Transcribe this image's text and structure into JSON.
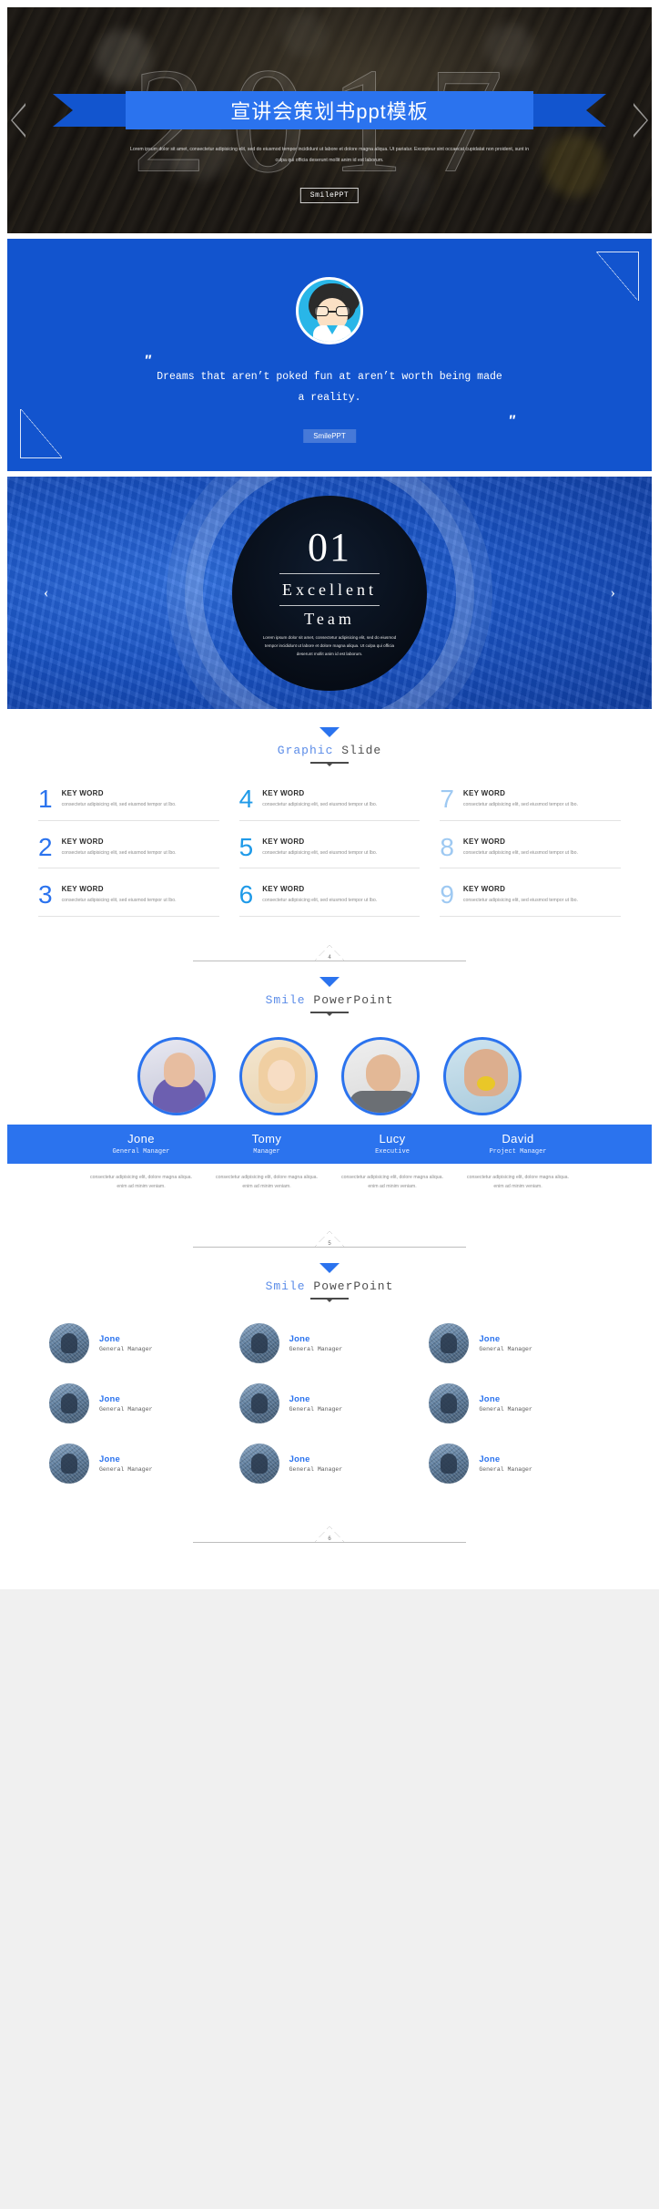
{
  "cover": {
    "year_ghost": "2017",
    "title": "宣讲会策划书ppt模板",
    "subtitle": "Lorem ipsum dolor sit amet, consectetur adipisicing elit, sed do eiusmod tempor incididunt ut labore et dolore magna aliqua. Ut pariatur. Excepteur sint occaecat cupidatat non proident, sunt in culpa qui officia deserunt mollit anim id est laborum.",
    "badge": "SmilePPT",
    "nav_left": "chevron-left",
    "nav_right": "chevron-right"
  },
  "quote_slide": {
    "quote_mark_open": "\"",
    "quote_mark_close": "\"",
    "text": "Dreams that aren’t poked fun at aren’t worth being made a reality.",
    "button": "SmilePPT",
    "accent": "#1254ce",
    "avatar": "boy-with-glasses-avatar"
  },
  "section_slide": {
    "number": "01",
    "title_line1": "Excellent",
    "title_line2": "Team",
    "description": "Lorem ipsum dolor sit amet, consectetur adipisicing elit, sed do eiusmod tempor incididunt ut labore et dolore magna aliqua. Ut culpa qui officia deserunt mollit anim id est laborum.",
    "prev": "‹",
    "next": "›"
  },
  "graphic_section": {
    "heading_accent": "Graphic",
    "heading_rest": " Slide",
    "items": [
      {
        "num": "1",
        "title": "KEY WORD",
        "desc": "consectetur adipisicing elit, sed eiusmod tempor ut lbo.",
        "color": "#2b73ee"
      },
      {
        "num": "4",
        "title": "KEY WORD",
        "desc": "consectetur adipisicing elit, sed eiusmod tempor ut lbo.",
        "color": "#1f9ae8"
      },
      {
        "num": "7",
        "title": "KEY WORD",
        "desc": "consectetur adipisicing elit, sed eiusmod tempor ut lbo.",
        "color": "#9ec9f2"
      },
      {
        "num": "2",
        "title": "KEY WORD",
        "desc": "consectetur adipisicing elit, sed eiusmod tempor ut lbo.",
        "color": "#2b73ee"
      },
      {
        "num": "5",
        "title": "KEY WORD",
        "desc": "consectetur adipisicing elit, sed eiusmod tempor ut lbo.",
        "color": "#1f9ae8"
      },
      {
        "num": "8",
        "title": "KEY WORD",
        "desc": "consectetur adipisicing elit, sed eiusmod tempor ut lbo.",
        "color": "#9ec9f2"
      },
      {
        "num": "3",
        "title": "KEY WORD",
        "desc": "consectetur adipisicing elit, sed eiusmod tempor ut lbo.",
        "color": "#2b73ee"
      },
      {
        "num": "6",
        "title": "KEY WORD",
        "desc": "consectetur adipisicing elit, sed eiusmod tempor ut lbo.",
        "color": "#1f9ae8"
      },
      {
        "num": "9",
        "title": "KEY WORD",
        "desc": "consectetur adipisicing elit, sed eiusmod tempor ut lbo.",
        "color": "#9ec9f2"
      }
    ]
  },
  "divider_4": {
    "number": "4"
  },
  "divider_5": {
    "number": "5"
  },
  "divider_6": {
    "number": "6"
  },
  "team_section": {
    "heading_accent": "Smile",
    "heading_rest": " PowerPoint",
    "members": [
      {
        "name": "Jone",
        "role": "General Manager",
        "desc": "consectetur adipisicing elit, dolore magna aliqua. enim ad minim veniam.",
        "photo": "man-purple-polo-photo"
      },
      {
        "name": "Tomy",
        "role": "Manager",
        "desc": "consectetur adipisicing elit, dolore magna aliqua. enim ad minim veniam.",
        "photo": "woman-surprised-photo"
      },
      {
        "name": "Lucy",
        "role": "Executive",
        "desc": "consectetur adipisicing elit, dolore magna aliqua. enim ad minim veniam.",
        "photo": "person-hands-on-face-photo"
      },
      {
        "name": "David",
        "role": "Project Manager",
        "desc": "consectetur adipisicing elit, dolore magna aliqua. enim ad minim veniam.",
        "photo": "man-lemon-mouth-photo"
      }
    ]
  },
  "people_section": {
    "heading_accent": "Smile",
    "heading_rest": " PowerPoint",
    "people": [
      {
        "name": "Jone",
        "role": "General Manager",
        "photo": "person-photo-1"
      },
      {
        "name": "Jone",
        "role": "General Manager",
        "photo": "person-photo-2"
      },
      {
        "name": "Jone",
        "role": "General Manager",
        "photo": "person-photo-3"
      },
      {
        "name": "Jone",
        "role": "General Manager",
        "photo": "person-photo-4"
      },
      {
        "name": "Jone",
        "role": "General Manager",
        "photo": "person-photo-5"
      },
      {
        "name": "Jone",
        "role": "General Manager",
        "photo": "person-photo-6"
      },
      {
        "name": "Jone",
        "role": "General Manager",
        "photo": "person-photo-7"
      },
      {
        "name": "Jone",
        "role": "General Manager",
        "photo": "person-photo-8"
      },
      {
        "name": "Jone",
        "role": "General Manager",
        "photo": "person-photo-9"
      }
    ]
  }
}
